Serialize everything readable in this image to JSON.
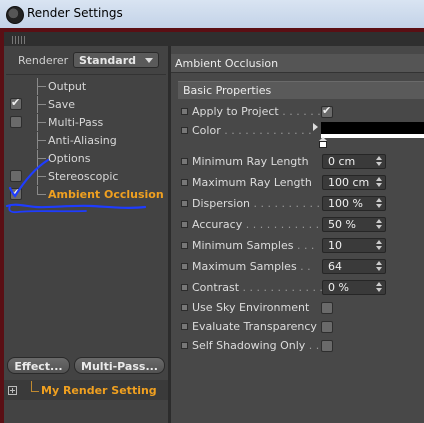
{
  "window": {
    "title": "Render Settings"
  },
  "renderer": {
    "label": "Renderer",
    "value": "Standard"
  },
  "nav": {
    "items": [
      {
        "label": "Output",
        "checkbox": false,
        "checked": false,
        "active": false
      },
      {
        "label": "Save",
        "checkbox": true,
        "checked": true,
        "active": false
      },
      {
        "label": "Multi-Pass",
        "checkbox": true,
        "checked": false,
        "active": false
      },
      {
        "label": "Anti-Aliasing",
        "checkbox": false,
        "checked": false,
        "active": false
      },
      {
        "label": "Options",
        "checkbox": false,
        "checked": false,
        "active": false
      },
      {
        "label": "Stereoscopic",
        "checkbox": true,
        "checked": false,
        "active": false
      },
      {
        "label": "Ambient Occlusion",
        "checkbox": true,
        "checked": true,
        "active": true
      }
    ]
  },
  "buttons": {
    "effect": "Effect...",
    "multipass": "Multi-Pass..."
  },
  "render_setting": {
    "label": "My Render Setting"
  },
  "panel": {
    "title": "Ambient Occlusion",
    "section": "Basic Properties",
    "apply": {
      "label": "Apply to Project",
      "checked": true
    },
    "color": {
      "label": "Color",
      "value": "#000000"
    },
    "fields": [
      {
        "label": "Minimum Ray Length",
        "value": "0 cm"
      },
      {
        "label": "Maximum Ray Length",
        "value": "100 cm"
      },
      {
        "label": "Dispersion",
        "value": "100 %"
      },
      {
        "label": "Accuracy",
        "value": "50 %"
      },
      {
        "label": "Minimum Samples",
        "value": "10"
      },
      {
        "label": "Maximum Samples",
        "value": "64"
      },
      {
        "label": "Contrast",
        "value": "0 %"
      }
    ],
    "checks": [
      {
        "label": "Use Sky Environment",
        "checked": false
      },
      {
        "label": "Evaluate Transparency",
        "checked": false
      },
      {
        "label": "Self Shadowing Only",
        "checked": false
      }
    ]
  },
  "colors": {
    "accent": "#f0a020",
    "annotation": "#1e3cff",
    "frame": "#5a0f14"
  }
}
